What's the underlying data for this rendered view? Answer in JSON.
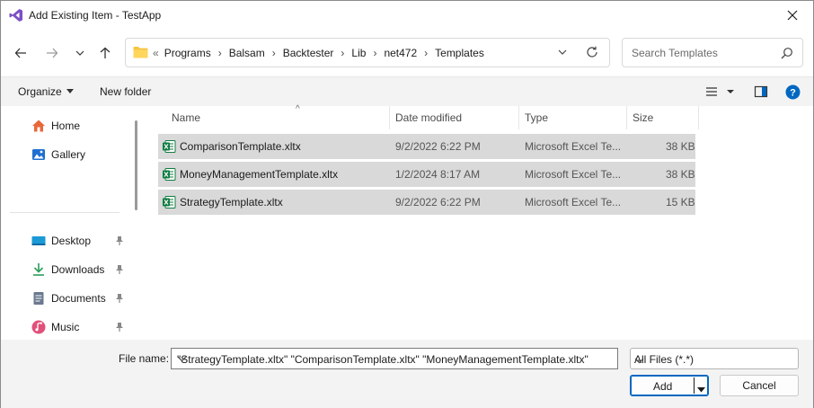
{
  "window": {
    "title": "Add Existing Item - TestApp"
  },
  "address": {
    "overflow": "«",
    "crumbs": [
      "Programs",
      "Balsam",
      "Backtester",
      "Lib",
      "net472",
      "Templates"
    ]
  },
  "search": {
    "placeholder": "Search Templates"
  },
  "commands": {
    "organize": "Organize",
    "new_folder": "New folder"
  },
  "nav": {
    "quick": [
      {
        "label": "Home",
        "icon": "home-icon"
      },
      {
        "label": "Gallery",
        "icon": "gallery-icon"
      }
    ],
    "pinned": [
      {
        "label": "Desktop",
        "icon": "desktop-icon"
      },
      {
        "label": "Downloads",
        "icon": "download-icon"
      },
      {
        "label": "Documents",
        "icon": "documents-icon"
      },
      {
        "label": "Music",
        "icon": "music-icon"
      }
    ]
  },
  "columns": {
    "name": "Name",
    "date": "Date modified",
    "type": "Type",
    "size": "Size"
  },
  "files": [
    {
      "name": "ComparisonTemplate.xltx",
      "date": "9/2/2022 6:22 PM",
      "type": "Microsoft Excel Te...",
      "size": "38 KB",
      "selected": true
    },
    {
      "name": "MoneyManagementTemplate.xltx",
      "date": "1/2/2024 8:17 AM",
      "type": "Microsoft Excel Te...",
      "size": "38 KB",
      "selected": true
    },
    {
      "name": "StrategyTemplate.xltx",
      "date": "9/2/2022 6:22 PM",
      "type": "Microsoft Excel Te...",
      "size": "15 KB",
      "selected": true
    }
  ],
  "footer": {
    "file_name_label": "File name:",
    "file_name_value": "\"StrategyTemplate.xltx\" \"ComparisonTemplate.xltx\" \"MoneyManagementTemplate.xltx\"",
    "filter_value": "All Files (*.*)",
    "add_label": "Add",
    "cancel_label": "Cancel"
  },
  "colors": {
    "accent": "#0067c0",
    "selection": "#d9d9d9",
    "excel": "#107c41",
    "folder": "#f4c542"
  }
}
